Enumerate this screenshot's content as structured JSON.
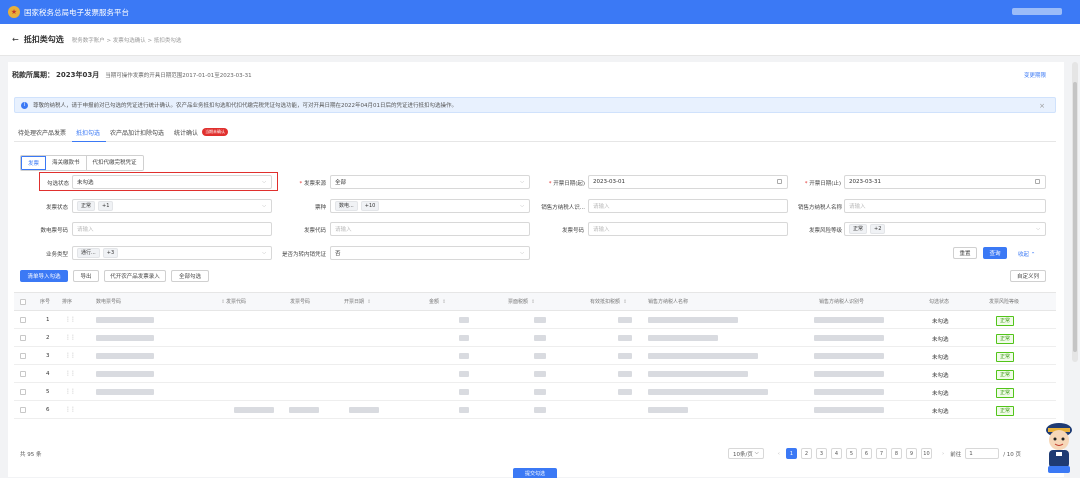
{
  "app": {
    "title": "国家税务总局电子发票服务平台"
  },
  "subheader": {
    "back_icon": "←",
    "title": "抵扣类勾选",
    "breadcrumb": "税务数字账户 > 发票勾选确认 > 抵扣类勾选"
  },
  "period": {
    "label": "税款所属期：",
    "value": "2023年03月",
    "note": "当期可操作发票的开具日期范围2017-01-01至2023-03-31",
    "change_link": "变更期限"
  },
  "notice": {
    "text": "尊敬的纳税人，请于申报前对已勾选的凭证进行统计确认。农产品业务抵扣勾选和代扣代缴完税凭证勾选功能，可对开具日期在2022年04月01日后的凭证进行抵扣勾选操作。"
  },
  "main_tabs": [
    {
      "label": "待处理农产品发票"
    },
    {
      "label": "抵扣勾选"
    },
    {
      "label": "农产品加计扣除勾选"
    },
    {
      "label": "统计确认",
      "badge": "当期未确认"
    }
  ],
  "sub_tabs": [
    {
      "label": "发票"
    },
    {
      "label": "海关缴款书"
    },
    {
      "label": "代扣代缴完税凭证"
    }
  ],
  "filters": {
    "select_status": {
      "label": "勾选状态",
      "value": "未勾选"
    },
    "invoice_source": {
      "label": "发票来源",
      "value": "全部"
    },
    "date_start": {
      "label": "开票日期(起)",
      "value": "2023-03-01"
    },
    "date_end": {
      "label": "开票日期(止)",
      "value": "2023-03-31"
    },
    "invoice_status": {
      "label": "发票状态",
      "tag": "正常",
      "more": "+1"
    },
    "invoice_kind": {
      "label": "票种",
      "tag": "数电...",
      "more": "+10"
    },
    "seller_id": {
      "label": "销售方纳税人识...",
      "placeholder": "请输入"
    },
    "seller_name": {
      "label": "销售方纳税人名称",
      "placeholder": "请输入"
    },
    "digital_no": {
      "label": "数电票号码",
      "placeholder": "请输入"
    },
    "invoice_code": {
      "label": "发票代码",
      "placeholder": "请输入"
    },
    "invoice_no": {
      "label": "发票号码",
      "placeholder": "请输入"
    },
    "risk_level": {
      "label": "发票风险等级",
      "tag": "正常",
      "more": "+2"
    },
    "biz_type": {
      "label": "业务类型",
      "tag": "通行...",
      "more": "+3"
    },
    "ext_vat": {
      "label": "是否为转内销凭证",
      "value": "否"
    }
  },
  "actions": {
    "reset": "重置",
    "query": "查询",
    "collapse": "收起"
  },
  "toolbar": {
    "import_select": "清单导入勾选",
    "export": "导出",
    "agri_import": "代开农产品发票录入",
    "select_all": "全部勾选",
    "custom_cols": "自定义列"
  },
  "table": {
    "headers": {
      "seq": "序号",
      "sort": "排序",
      "digital_no": "数电票号码",
      "code": "发票代码",
      "number": "发票号码",
      "date": "开票日期",
      "amount": "金额",
      "tax": "票面税额",
      "valid_tax": "有效抵扣税额",
      "seller_name": "销售方纳税人名称",
      "seller_id": "销售方纳税人识别号",
      "select_status": "勾选状态",
      "risk": "发票风险等级"
    },
    "rows": [
      {
        "seq": "1",
        "select_status": "未勾选",
        "risk": "正常"
      },
      {
        "seq": "2",
        "select_status": "未勾选",
        "risk": "正常"
      },
      {
        "seq": "3",
        "select_status": "未勾选",
        "risk": "正常"
      },
      {
        "seq": "4",
        "select_status": "未勾选",
        "risk": "正常"
      },
      {
        "seq": "5",
        "select_status": "未勾选",
        "risk": "正常"
      },
      {
        "seq": "6",
        "select_status": "未勾选",
        "risk": "正常"
      }
    ]
  },
  "pagination": {
    "total": "共 95 条",
    "page_size": "10条/页",
    "pages": [
      "1",
      "2",
      "3",
      "4",
      "5",
      "6",
      "7",
      "8",
      "9",
      "10"
    ],
    "goto_label": "前往",
    "goto_value": "1",
    "page_count": "/ 10 页"
  },
  "footer": {
    "submit": "提交勾选"
  },
  "colors": {
    "brand": "#3b79f5",
    "ok": "#52c41a",
    "danger": "#e0302e"
  }
}
